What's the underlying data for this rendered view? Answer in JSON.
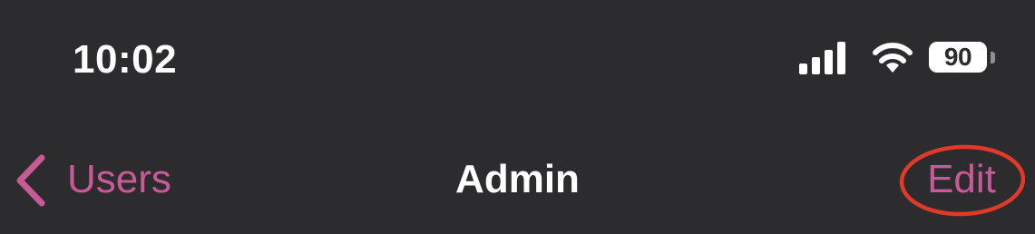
{
  "status_bar": {
    "time": "10:02",
    "signal_icon": "cellular-signal-icon",
    "wifi_icon": "wifi-icon",
    "battery_level": "90"
  },
  "nav_bar": {
    "back_label": "Users",
    "back_icon": "chevron-left-icon",
    "title": "Admin",
    "edit_label": "Edit"
  },
  "colors": {
    "background": "#2c2c2e",
    "accent": "#c85a98",
    "highlight": "#e03a2a",
    "text": "#ffffff"
  }
}
